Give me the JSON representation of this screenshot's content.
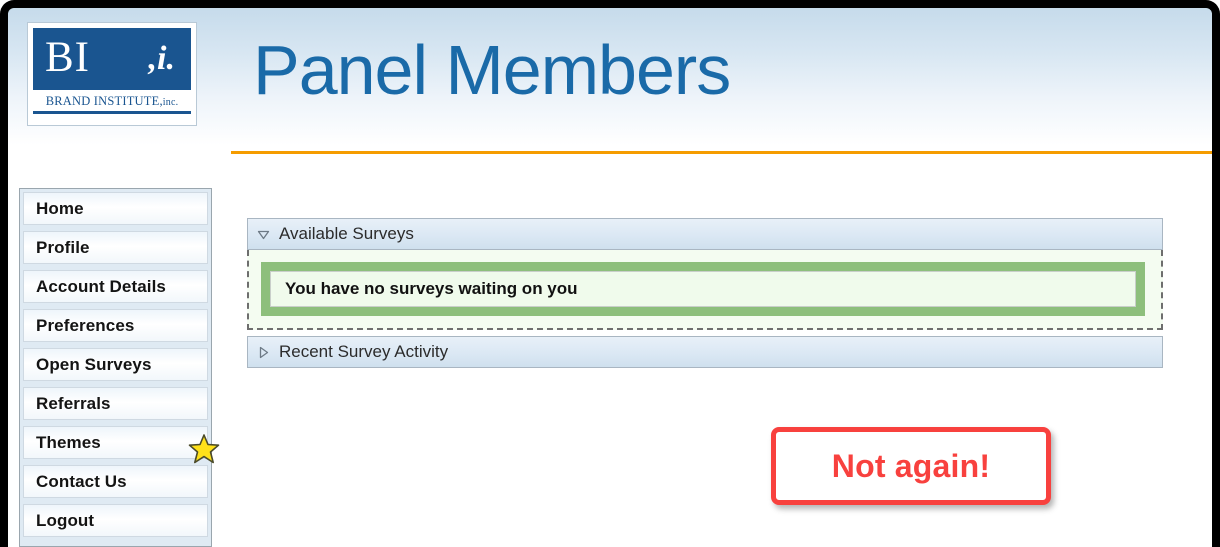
{
  "header": {
    "title": "Panel Members",
    "logo": {
      "mark_left": "BI",
      "mark_right": ",i.",
      "name_main": "BRAND  INSTITUTE,",
      "name_suffix": "inc.",
      "brand_color": "#1a5590"
    },
    "rule_color": "#f59c00",
    "title_color": "#1a6aa8"
  },
  "sidebar": {
    "items": [
      {
        "label": "Home"
      },
      {
        "label": "Profile"
      },
      {
        "label": "Account Details"
      },
      {
        "label": "Preferences"
      },
      {
        "label": "Open Surveys"
      },
      {
        "label": "Referrals"
      },
      {
        "label": "Themes"
      },
      {
        "label": "Contact Us"
      },
      {
        "label": "Logout"
      }
    ],
    "star": {
      "icon": "star-icon",
      "color": "#ffe11a",
      "outline": "#4b4b2a"
    }
  },
  "main": {
    "panels": [
      {
        "title": "Available Surveys",
        "expanded": true,
        "marker": "triangle-down-icon",
        "message": "You have no surveys waiting on you",
        "message_border_color": "#8dbf7c",
        "message_bg_color": "#f0fbec"
      },
      {
        "title": "Recent Survey Activity",
        "expanded": false,
        "marker": "triangle-right-icon"
      }
    ]
  },
  "annotation": {
    "text": "Not again!",
    "color": "#f8413e"
  }
}
